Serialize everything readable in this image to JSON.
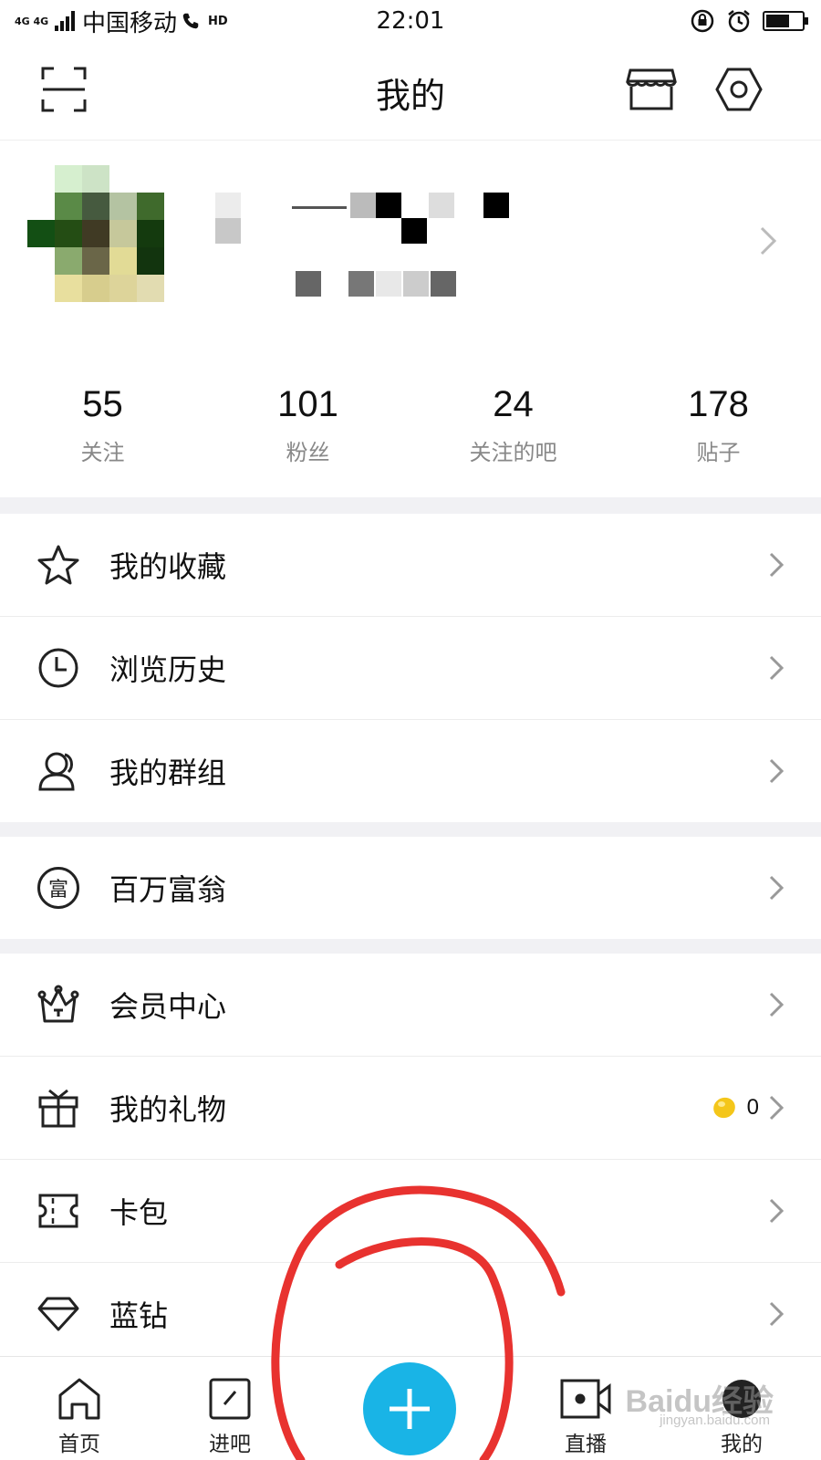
{
  "status_bar": {
    "network": "4G 4G",
    "carrier": "中国移动",
    "hd": "HD",
    "time": "22:01",
    "battery_level": 0.65
  },
  "header": {
    "title": "我的",
    "icons": [
      "scan-icon",
      "store-icon",
      "settings-icon"
    ]
  },
  "stats": [
    {
      "value": "55",
      "label": "关注"
    },
    {
      "value": "101",
      "label": "粉丝"
    },
    {
      "value": "24",
      "label": "关注的吧"
    },
    {
      "value": "178",
      "label": "贴子"
    }
  ],
  "menu": {
    "favorites": "我的收藏",
    "history": "浏览历史",
    "groups": "我的群组",
    "millionaire": "百万富翁",
    "millionaire_icon_char": "富",
    "vip_center": "会员中心",
    "gifts": "我的礼物",
    "gift_coins": "0",
    "card_wallet": "卡包",
    "blue_diamond": "蓝钻"
  },
  "tabbar": {
    "home": "首页",
    "jinba": "进吧",
    "live": "直播",
    "mine": "我的"
  },
  "colors": {
    "accent": "#19b4e6",
    "annotation": "#e8322f",
    "coin": "#f4c61a"
  },
  "watermark": {
    "logo": "Baidu经验",
    "url": "jingyan.baidu.com"
  }
}
